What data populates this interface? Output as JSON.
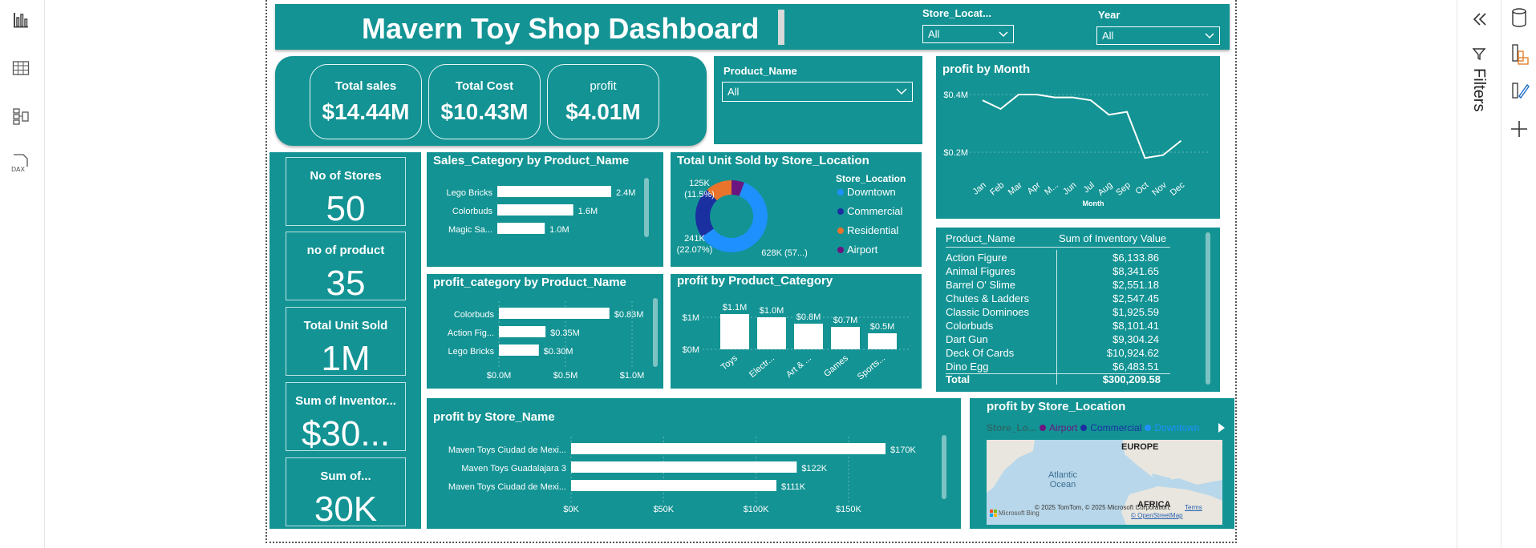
{
  "title": "Mavern Toy Shop Dashboard",
  "slicers": {
    "store_location": {
      "label": "Store_Locat...",
      "value": "All"
    },
    "year": {
      "label": "Year",
      "value": "All"
    },
    "product_name": {
      "label": "Product_Name",
      "value": "All"
    }
  },
  "kpis": [
    {
      "label": "Total sales",
      "value": "$14.44M"
    },
    {
      "label": "Total Cost",
      "value": "$10.43M"
    },
    {
      "label": "profit",
      "value": "$4.01M"
    }
  ],
  "cards": [
    {
      "label": "No of Stores",
      "value": "50"
    },
    {
      "label": "no of product",
      "value": "35"
    },
    {
      "label": "Total Unit Sold",
      "value": "1M"
    },
    {
      "label": "Sum of Inventor...",
      "value": "$30..."
    },
    {
      "label": "Sum of...",
      "value": "30K"
    }
  ],
  "filters_label": "Filters",
  "visuals": {
    "sales_category": {
      "title": "Sales_Category by Product_Name",
      "chart_data": {
        "type": "bar",
        "categories": [
          "Lego Bricks",
          "Colorbuds",
          "Magic Sa..."
        ],
        "values": [
          2.4,
          1.6,
          1.0
        ],
        "labels": [
          "2.4M",
          "1.6M",
          "1.0M"
        ]
      }
    },
    "profit_category": {
      "title": "profit_category by Product_Name",
      "chart_data": {
        "type": "bar",
        "categories": [
          "Colorbuds",
          "Action Fig...",
          "Lego Bricks"
        ],
        "values": [
          0.83,
          0.35,
          0.3
        ],
        "labels": [
          "$0.83M",
          "$0.35M",
          "$0.30M"
        ],
        "xticks": [
          "$0.0M",
          "$0.5M",
          "$1.0M"
        ],
        "xlim": [
          0,
          1.0
        ]
      }
    },
    "units_by_location": {
      "title": "Total Unit Sold by Store_Location",
      "legend_title": "Store_Location",
      "chart_data": {
        "type": "pie",
        "categories": [
          "Downtown",
          "Commercial",
          "Residential",
          "Airport"
        ],
        "values": [
          628,
          241,
          125,
          61
        ],
        "colors": [
          "#1e90ff",
          "#1a2fa0",
          "#e8742c",
          "#6b1680"
        ]
      },
      "data_labels": [
        "125K",
        "(11.5%)",
        "241K",
        "(22.07%)",
        "628K (57...)"
      ]
    },
    "profit_by_category": {
      "title": "profit by Product_Category",
      "chart_data": {
        "type": "bar",
        "categories": [
          "Toys",
          "Electr...",
          "Art & ...",
          "Games",
          "Sports..."
        ],
        "values": [
          1.1,
          1.0,
          0.8,
          0.7,
          0.5
        ],
        "labels": [
          "$1.1M",
          "$1.0M",
          "$0.8M",
          "$0.7M",
          "$0.5M"
        ],
        "yticks": [
          "$1M",
          "$0M"
        ],
        "ylim": [
          0,
          1.1
        ]
      }
    },
    "profit_by_month": {
      "title": "profit by Month",
      "chart_data": {
        "type": "line",
        "x": [
          "Jan",
          "Feb",
          "Mar",
          "Apr",
          "M...",
          "Jun",
          "Jul",
          "Aug",
          "Sep",
          "Oct",
          "Nov",
          "Dec"
        ],
        "values": [
          0.38,
          0.35,
          0.4,
          0.4,
          0.39,
          0.39,
          0.38,
          0.33,
          0.34,
          0.18,
          0.19,
          0.24
        ],
        "yticks": [
          "$0.4M",
          "$0.2M"
        ],
        "ylim": [
          0.1,
          0.45
        ],
        "xlabel": "Month"
      }
    },
    "inventory_table": {
      "columns": [
        "Product_Name",
        "Sum of Inventory Value"
      ],
      "rows": [
        [
          "Action Figure",
          "$6,133.86"
        ],
        [
          "Animal Figures",
          "$8,341.65"
        ],
        [
          "Barrel O' Slime",
          "$2,551.18"
        ],
        [
          "Chutes & Ladders",
          "$2,547.45"
        ],
        [
          "Classic Dominoes",
          "$1,925.59"
        ],
        [
          "Colorbuds",
          "$8,101.41"
        ],
        [
          "Dart Gun",
          "$9,304.24"
        ],
        [
          "Deck Of Cards",
          "$10,924.62"
        ],
        [
          "Dino Egg",
          "$6,483.51"
        ]
      ],
      "total_label": "Total",
      "total_value": "$300,209.58"
    },
    "profit_by_store": {
      "title": "profit by Store_Name",
      "chart_data": {
        "type": "bar",
        "categories": [
          "Maven Toys Ciudad de Mexi...",
          "Maven Toys Guadalajara 3",
          "Maven Toys Ciudad de Mexi..."
        ],
        "values": [
          170,
          122,
          111
        ],
        "labels": [
          "$170K",
          "$122K",
          "$111K"
        ],
        "xticks": [
          "$0K",
          "$50K",
          "$100K",
          "$150K"
        ],
        "xlim": [
          0,
          170
        ]
      }
    },
    "map": {
      "title": "profit by Store_Location",
      "legend_title": "Store_Lo...",
      "legend": [
        {
          "name": "Airport",
          "color": "#6b1680"
        },
        {
          "name": "Commercial",
          "color": "#1a2fa0"
        },
        {
          "name": "Downtown",
          "color": "#1e90ff"
        }
      ],
      "labels": {
        "continent1": "EUROPE",
        "ocean": "Atlantic Ocean",
        "continent2": "AFRICA"
      },
      "attribution": "© 2025 TomTom, © 2025 Microsoft Corporation,",
      "terms": "Terms",
      "osm": "© OpenStreetMap",
      "brand": "Microsoft Bing"
    }
  }
}
